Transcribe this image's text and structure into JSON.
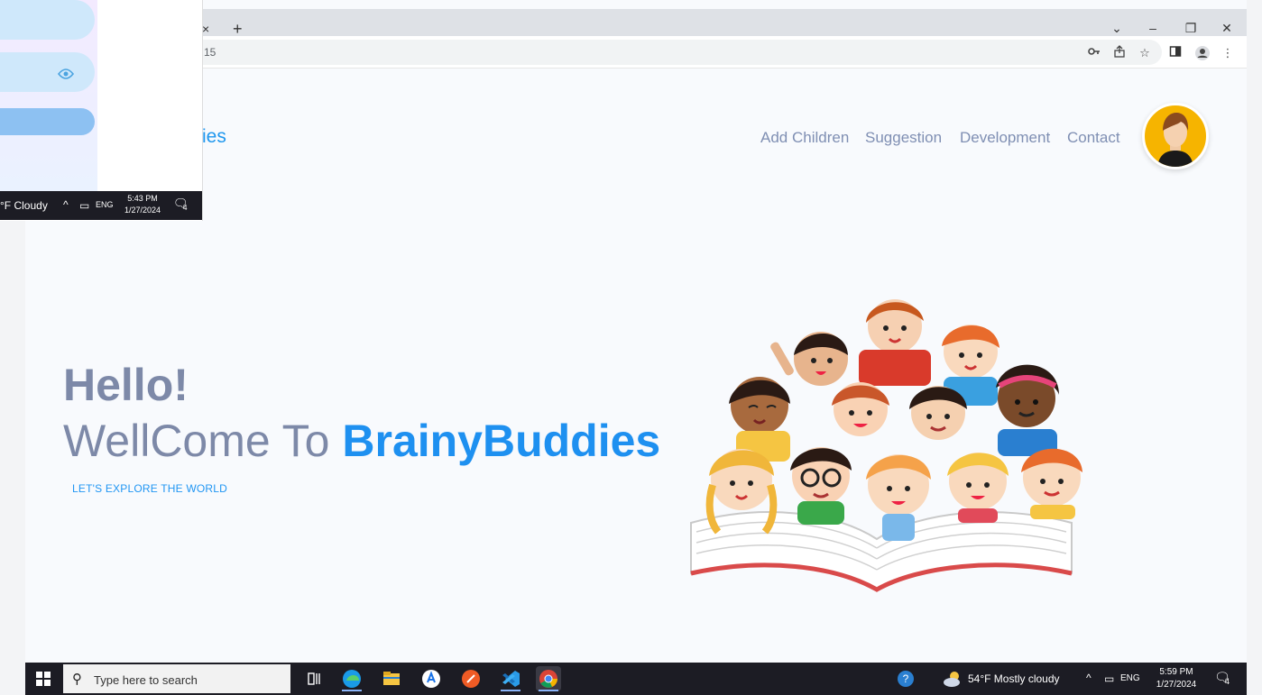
{
  "browser": {
    "tab_close": "×",
    "tab_new": "+",
    "url": "15",
    "window_controls": {
      "chevron": "⌄",
      "minimize": "–",
      "restore": "❐",
      "close": "✕"
    },
    "toolbar_icons": [
      "key-icon",
      "share-icon",
      "star-icon",
      "sidebar-icon",
      "profile-icon",
      "more-icon"
    ]
  },
  "site": {
    "logo_fragment": "ies",
    "nav": [
      "Add Children",
      "Suggestion",
      "Development",
      "Contact"
    ],
    "hero": {
      "hello": "Hello!",
      "welcome_prefix": "WellCome To ",
      "brand": "BrainyBuddies",
      "tagline": "LET'S EXPLORE THE WORLD"
    }
  },
  "taskbar": {
    "search_placeholder": "Type here to search",
    "weather": "54°F  Mostly cloudy",
    "lang": "ENG",
    "time": "5:59 PM",
    "date": "1/27/2024",
    "notif_count": "4"
  },
  "overlay": {
    "taskbar": {
      "weather": "°F  Cloudy",
      "lang": "ENG",
      "time": "5:43 PM",
      "date": "1/27/2024",
      "notif_count": "4"
    }
  },
  "colors": {
    "brand_blue": "#1e90f0",
    "nav_gray": "#7f8fb3",
    "taskbar": "#1c1c24"
  }
}
